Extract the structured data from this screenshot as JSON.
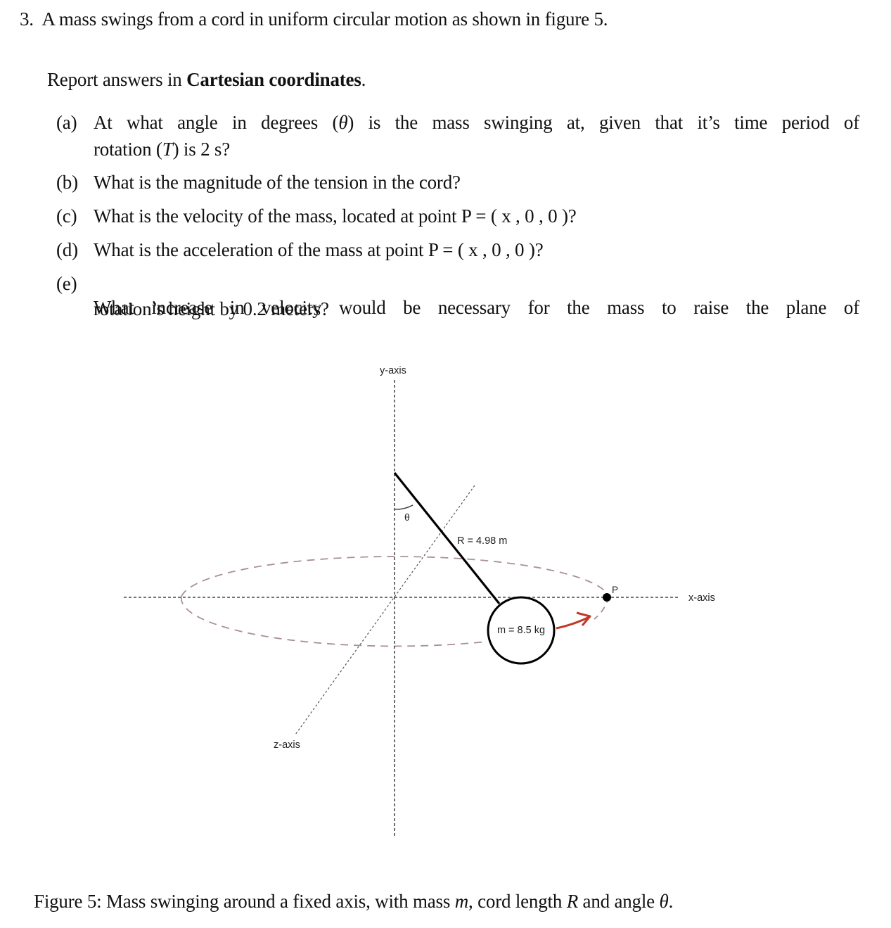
{
  "problem": {
    "number": "3.",
    "statement": "A mass swings from a cord in uniform circular motion as shown in figure 5.",
    "instruction_prefix": "Report answers in ",
    "instruction_bold": "Cartesian coordinates",
    "instruction_suffix": ".",
    "parts": [
      {
        "label": "(a)",
        "line1_a": "At what angle in degrees (",
        "line1_sym": "θ",
        "line1_b": ") is the mass swinging at, given that it’s time period of",
        "line2_a": "rotation (",
        "line2_sym": "T",
        "line2_b": ") is 2 s?"
      },
      {
        "label": "(b)",
        "text": "What is the magnitude of the tension in the cord?"
      },
      {
        "label": "(c)",
        "text": "What is the velocity of the mass, located at point P = ( x , 0 , 0 )?"
      },
      {
        "label": "(d)",
        "text": "What is the acceleration of the mass at point P = ( x , 0 , 0 )?"
      },
      {
        "label": "(e)",
        "line1": "What increase in velocity would be necessary for the mass to raise the plane of",
        "line2": "rotation’s height by 0.2 meters?"
      }
    ]
  },
  "figure": {
    "y_axis_label": "y-axis",
    "x_axis_label": "x-axis",
    "z_axis_label": "z-axis",
    "angle_label": "θ",
    "cord_label": "R = 4.98 m",
    "mass_label": "m = 8.5 kg",
    "point_label": "P",
    "colors": {
      "axis": "#222222",
      "orbit": "#a98f96",
      "arrow": "#c0392b",
      "cord": "#000000"
    },
    "caption": {
      "prefix": "Figure 5: Mass swinging around a fixed axis, with mass ",
      "m": "m",
      "mid": ", cord length ",
      "R": "R",
      "mid2": " and angle ",
      "theta": "θ",
      "suffix": "."
    }
  }
}
